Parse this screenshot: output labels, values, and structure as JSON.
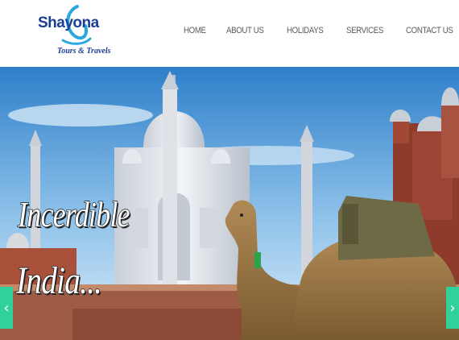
{
  "brand": {
    "name": "Shayona",
    "tagline": "Tours & Travels",
    "primary_color": "#1c3f94",
    "accent_color": "#29a8df"
  },
  "nav": {
    "items": [
      {
        "label": "HOME"
      },
      {
        "label": "ABOUT US"
      },
      {
        "label": "HOLIDAYS"
      },
      {
        "label": "SERVICES"
      },
      {
        "label": "CONTACT US"
      }
    ]
  },
  "hero": {
    "headline_line1": "Incerdible",
    "headline_line2": "India...",
    "prev_icon": "chevron-left-icon",
    "next_icon": "chevron-right-icon",
    "prev_glyph": "‹",
    "next_glyph": "›",
    "arrow_color": "#2fd39a"
  }
}
